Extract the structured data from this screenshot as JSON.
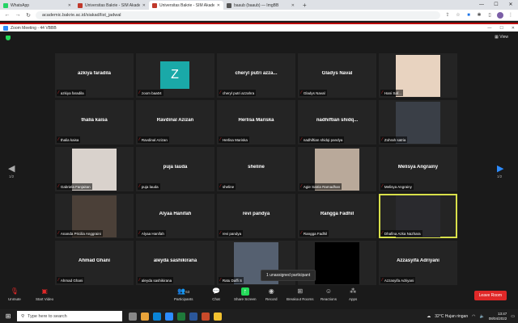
{
  "browser": {
    "tabs": [
      {
        "title": "WhatsApp",
        "color": "#25d366",
        "active": false
      },
      {
        "title": "Universitas Bakrie - SIM Akadem...",
        "color": "#c0392b",
        "active": false
      },
      {
        "title": "Universitas Bakrie - SIM Akadem...",
        "color": "#c0392b",
        "active": true
      },
      {
        "title": "baaub (baaub) — ImgBB",
        "color": "#555555",
        "active": false
      }
    ],
    "url": "academic.bakrie.ac.id/siakad/list_jadwal"
  },
  "zoom": {
    "window_title": "Zoom Meeting - 44 VBBB",
    "view_label": "View",
    "page_left": "1/2",
    "page_right": "1/2",
    "tooltip": "1 unassigned participant",
    "participants": [
      {
        "big": "azkiya faradila",
        "foot": "azkiya faradila",
        "kind": "name"
      },
      {
        "big": "Z",
        "foot": "zoom baa04",
        "kind": "zbox"
      },
      {
        "big": "cheryl putri azza...",
        "foot": "cheryl putri azzahra",
        "kind": "name"
      },
      {
        "big": "Gladys Naval",
        "foot": "Gladys Naval",
        "kind": "name"
      },
      {
        "big": "",
        "foot": "Hani Saf...",
        "kind": "photo",
        "color": "#e8d3c0"
      },
      {
        "big": "thalia kaisa",
        "foot": "thalia kaisa",
        "kind": "name"
      },
      {
        "big": "Ravdinal Azizan",
        "foot": "Ravdinal Azizan",
        "kind": "name"
      },
      {
        "big": "Herlisa Mariska",
        "foot": "Herlisa Mariska",
        "kind": "name"
      },
      {
        "big": "nadhiftian  shidq...",
        "foot": "nadhiftian shidqi pandya",
        "kind": "name"
      },
      {
        "big": "",
        "foot": "Zohrah satria",
        "kind": "photo",
        "color": "#3a3f47"
      },
      {
        "big": "",
        "foot": "Gabriela Fanjaitan",
        "kind": "photo",
        "color": "#d9d2cc"
      },
      {
        "big": "puja lauda",
        "foot": "puja lauda",
        "kind": "name"
      },
      {
        "big": "sheline",
        "foot": "sheline",
        "kind": "name"
      },
      {
        "big": "",
        "foot": "Agie Satria Ramadhan",
        "kind": "photo",
        "color": "#b9a99a"
      },
      {
        "big": "Melisya Angrainy",
        "foot": "Melisya Angrainy",
        "kind": "name"
      },
      {
        "big": "",
        "foot": "Ananda Pricilia Anggraini",
        "kind": "photo",
        "color": "#4b4038"
      },
      {
        "big": "Alyaa Hanifah",
        "foot": "Alyaa Hanifah",
        "kind": "name"
      },
      {
        "big": "revi pandya",
        "foot": "revi pandya",
        "kind": "name"
      },
      {
        "big": "Rangga Fadhil",
        "foot": "Rangga Fadhil",
        "kind": "name"
      },
      {
        "big": "",
        "foot": "Dhafina Azka Nazhara",
        "kind": "photo",
        "color": "#2a2a2e",
        "speaker": true
      },
      {
        "big": "Ahmad Ghani",
        "foot": "Ahmad Ghani",
        "kind": "name"
      },
      {
        "big": "aleyda sashikirana",
        "foot": "aleyda sashikirana",
        "kind": "name"
      },
      {
        "big": "",
        "foot": "Ratu Daffi S",
        "kind": "photo",
        "color": "#556070"
      },
      {
        "big": "",
        "foot": "",
        "kind": "photo",
        "color": "#000000"
      },
      {
        "big": "Azzasyifa Adriyani",
        "foot": "Azzasyifa Adriyani",
        "kind": "name"
      }
    ],
    "toolbar": {
      "unmute": "Unmute",
      "start_video": "Start Video",
      "participants": "Participants",
      "participant_count": "63",
      "chat": "Chat",
      "share_screen": "Share Screen",
      "record": "Record",
      "breakout": "Breakout Rooms",
      "reactions": "Reactions",
      "apps": "Apps",
      "leave": "Leave Room"
    }
  },
  "taskbar": {
    "search_placeholder": "Type here to search",
    "weather": "32°C  Hujan ringan",
    "time": "13:47",
    "date": "08/04/2022"
  }
}
